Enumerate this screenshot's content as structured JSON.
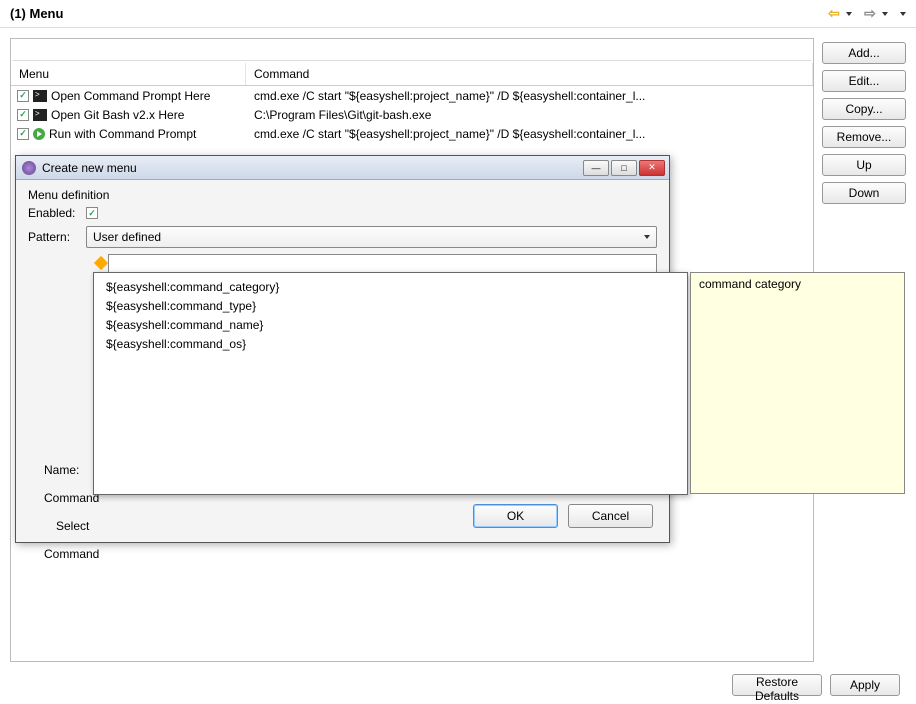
{
  "header": {
    "title": "(1) Menu"
  },
  "table": {
    "cols": {
      "menu": "Menu",
      "command": "Command"
    },
    "rows": [
      {
        "checked": true,
        "icon": "terminal",
        "label": "Open Command Prompt Here",
        "cmd": "cmd.exe /C start \"${easyshell:project_name}\" /D ${easyshell:container_l..."
      },
      {
        "checked": true,
        "icon": "terminal",
        "label": "Open Git Bash v2.x Here",
        "cmd": "C:\\Program Files\\Git\\git-bash.exe"
      },
      {
        "checked": true,
        "icon": "run",
        "label": "Run with Command Prompt",
        "cmd": "cmd.exe /C start \"${easyshell:project_name}\" /D ${easyshell:container_l..."
      }
    ]
  },
  "buttons": {
    "add": "Add...",
    "edit": "Edit...",
    "copy": "Copy...",
    "remove": "Remove...",
    "up": "Up",
    "down": "Down",
    "restore": "Restore Defaults",
    "apply": "Apply"
  },
  "dialog": {
    "title": "Create new menu",
    "section": "Menu definition",
    "labels": {
      "enabled": "Enabled:",
      "pattern": "Pattern:",
      "name": "Name:",
      "command": "Command",
      "select": "Select",
      "command2": "Command"
    },
    "pattern_value": "User defined",
    "ok": "OK",
    "cancel": "Cancel"
  },
  "suggest": {
    "items": [
      "${easyshell:command_category}",
      "${easyshell:command_type}",
      "${easyshell:command_name}",
      "${easyshell:command_os}"
    ]
  },
  "tooltip": {
    "text": "command category"
  }
}
